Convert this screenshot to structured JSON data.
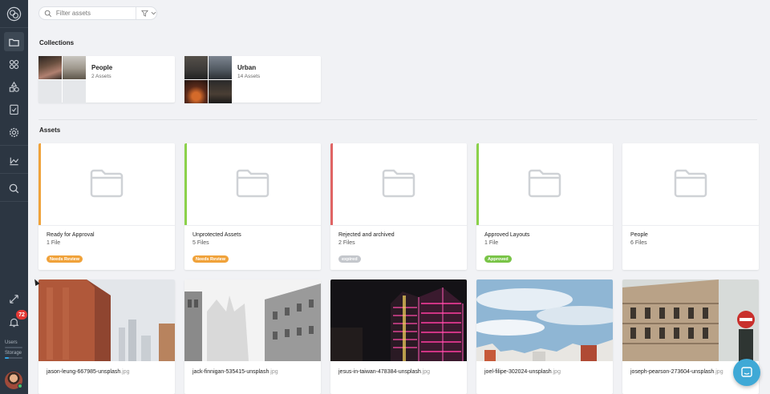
{
  "sidebar": {
    "nav": [
      {
        "icon": "folder-icon",
        "active": true
      },
      {
        "icon": "apps-icon",
        "active": false
      },
      {
        "icon": "shapes-icon",
        "active": false
      },
      {
        "icon": "clipboard-check-icon",
        "active": false
      },
      {
        "icon": "gear-icon",
        "active": false
      },
      {
        "icon": "chart-icon",
        "active": false
      },
      {
        "icon": "search-icon",
        "active": false
      }
    ],
    "notifications_count": "72",
    "users_label": "Users",
    "storage_label": "Storage",
    "storage_fraction": 0.22
  },
  "search": {
    "placeholder": "Filter assets"
  },
  "collections": {
    "heading": "Collections",
    "items": [
      {
        "title": "People",
        "count": "2 Assets"
      },
      {
        "title": "Urban",
        "count": "14 Assets"
      }
    ]
  },
  "assets": {
    "heading": "Assets",
    "folders": [
      {
        "title": "Ready for Approval",
        "count": "1 File",
        "tag": "Needs Review",
        "color": "#f0a23a",
        "tag_color": "#f0a23a"
      },
      {
        "title": "Unprotected Assets",
        "count": "5 Files",
        "tag": "Needs Review",
        "color": "#8bd14a",
        "tag_color": "#f0a23a"
      },
      {
        "title": "Rejected and archived",
        "count": "2 Files",
        "tag": "expired",
        "color": "#e06464",
        "tag_color": "#c4c7cc"
      },
      {
        "title": "Approved Layouts",
        "count": "1 File",
        "tag": "Approved",
        "color": "#8bd14a",
        "tag_color": "#79c447"
      },
      {
        "title": "People",
        "count": "6 Files",
        "tag": "",
        "color": "",
        "tag_color": ""
      }
    ],
    "files": [
      {
        "name": "jason-leung-667985-unsplash",
        "ext": ".jpg"
      },
      {
        "name": "jack-finnigan-535415-unsplash",
        "ext": ".jpg"
      },
      {
        "name": "jesus-in-taiwan-478384-unsplash",
        "ext": ".jpg"
      },
      {
        "name": "joel-filipe-302024-unsplash",
        "ext": ".jpg"
      },
      {
        "name": "joseph-pearson-273604-unsplash",
        "ext": ".jpg"
      }
    ]
  }
}
